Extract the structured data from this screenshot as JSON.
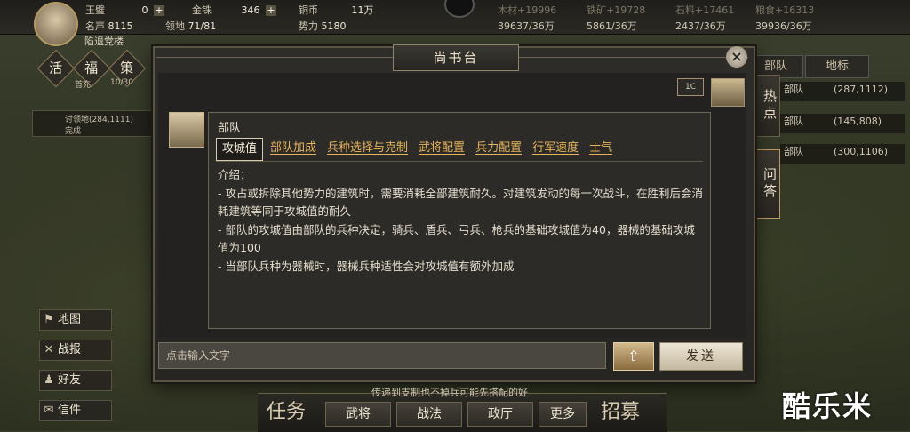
{
  "topbar": {
    "jade_label": "玉璧",
    "jade_value": "0",
    "gold_label": "金铢",
    "gold_value": "346",
    "copper_label": "铜币",
    "copper_value": "11万",
    "fame_label": "名声",
    "fame_value": "8115",
    "territory_label": "领地",
    "territory_value": "71/81",
    "power_label": "势力",
    "power_value": "5180",
    "res_wood": "木材+19996",
    "res_wood_val": "39637/36万",
    "res_iron": "铁矿+19728",
    "res_iron_val": "5861/36万",
    "res_stone": "石料+17461",
    "res_stone_val": "2437/36万",
    "res_grain": "粮食+16313",
    "res_grain_val": "39936/36万"
  },
  "player": {
    "name": "陷退党楼"
  },
  "left": {
    "btn1": "活",
    "btn2": "福",
    "btn2_sub": "首充",
    "btn3": "策",
    "btn3_sub": "10/30",
    "city_text": "讨领地(284,1111)",
    "city_sub": "完成",
    "menu": [
      {
        "icon": "⚑",
        "label": "地图"
      },
      {
        "icon": "✕",
        "label": "战报"
      },
      {
        "icon": "♟",
        "label": "好友"
      },
      {
        "icon": "✉",
        "label": "信件"
      }
    ]
  },
  "right": {
    "tab1": "部队",
    "tab2": "地标",
    "rows": [
      {
        "name": "部队",
        "coord": "(287,1112)"
      },
      {
        "name": "部队",
        "coord": "(145,808)"
      },
      {
        "name": "部队",
        "coord": "(300,1106)"
      }
    ],
    "vtab_hot": "热点",
    "vtab_qa": "问答"
  },
  "dialog": {
    "title": "尚书台",
    "close": "×",
    "me_badge": "1C",
    "bubble_title": "部队",
    "tabs": [
      "攻城值",
      "部队加成",
      "兵种选择与克制",
      "武将配置",
      "兵力配置",
      "行军速度",
      "士气"
    ],
    "active_tab": 0,
    "content_lines": [
      "介绍：",
      "- 攻占或拆除其他势力的建筑时，需要消耗全部建筑耐久。对建筑发动的每一次战斗，在胜利后会消耗建筑等同于攻城值的耐久",
      "- 部队的攻城值由部队的兵种决定，骑兵、盾兵、弓兵、枪兵的基础攻城值为40，器械的基础攻城值为100",
      "- 当部队兵种为器械时，器械兵种适性会对攻城值有额外加成"
    ],
    "input_placeholder": "点击输入文字",
    "up_icon": "⇧",
    "send_label": "发送"
  },
  "bottom": {
    "tip": "传递到支制也不掉兵可能先搭配的好",
    "task": "任务",
    "generals": "武将",
    "tactics": "战法",
    "politics": "政厅",
    "more": "更多",
    "recruit": "招募"
  },
  "watermark": "酷乐米"
}
